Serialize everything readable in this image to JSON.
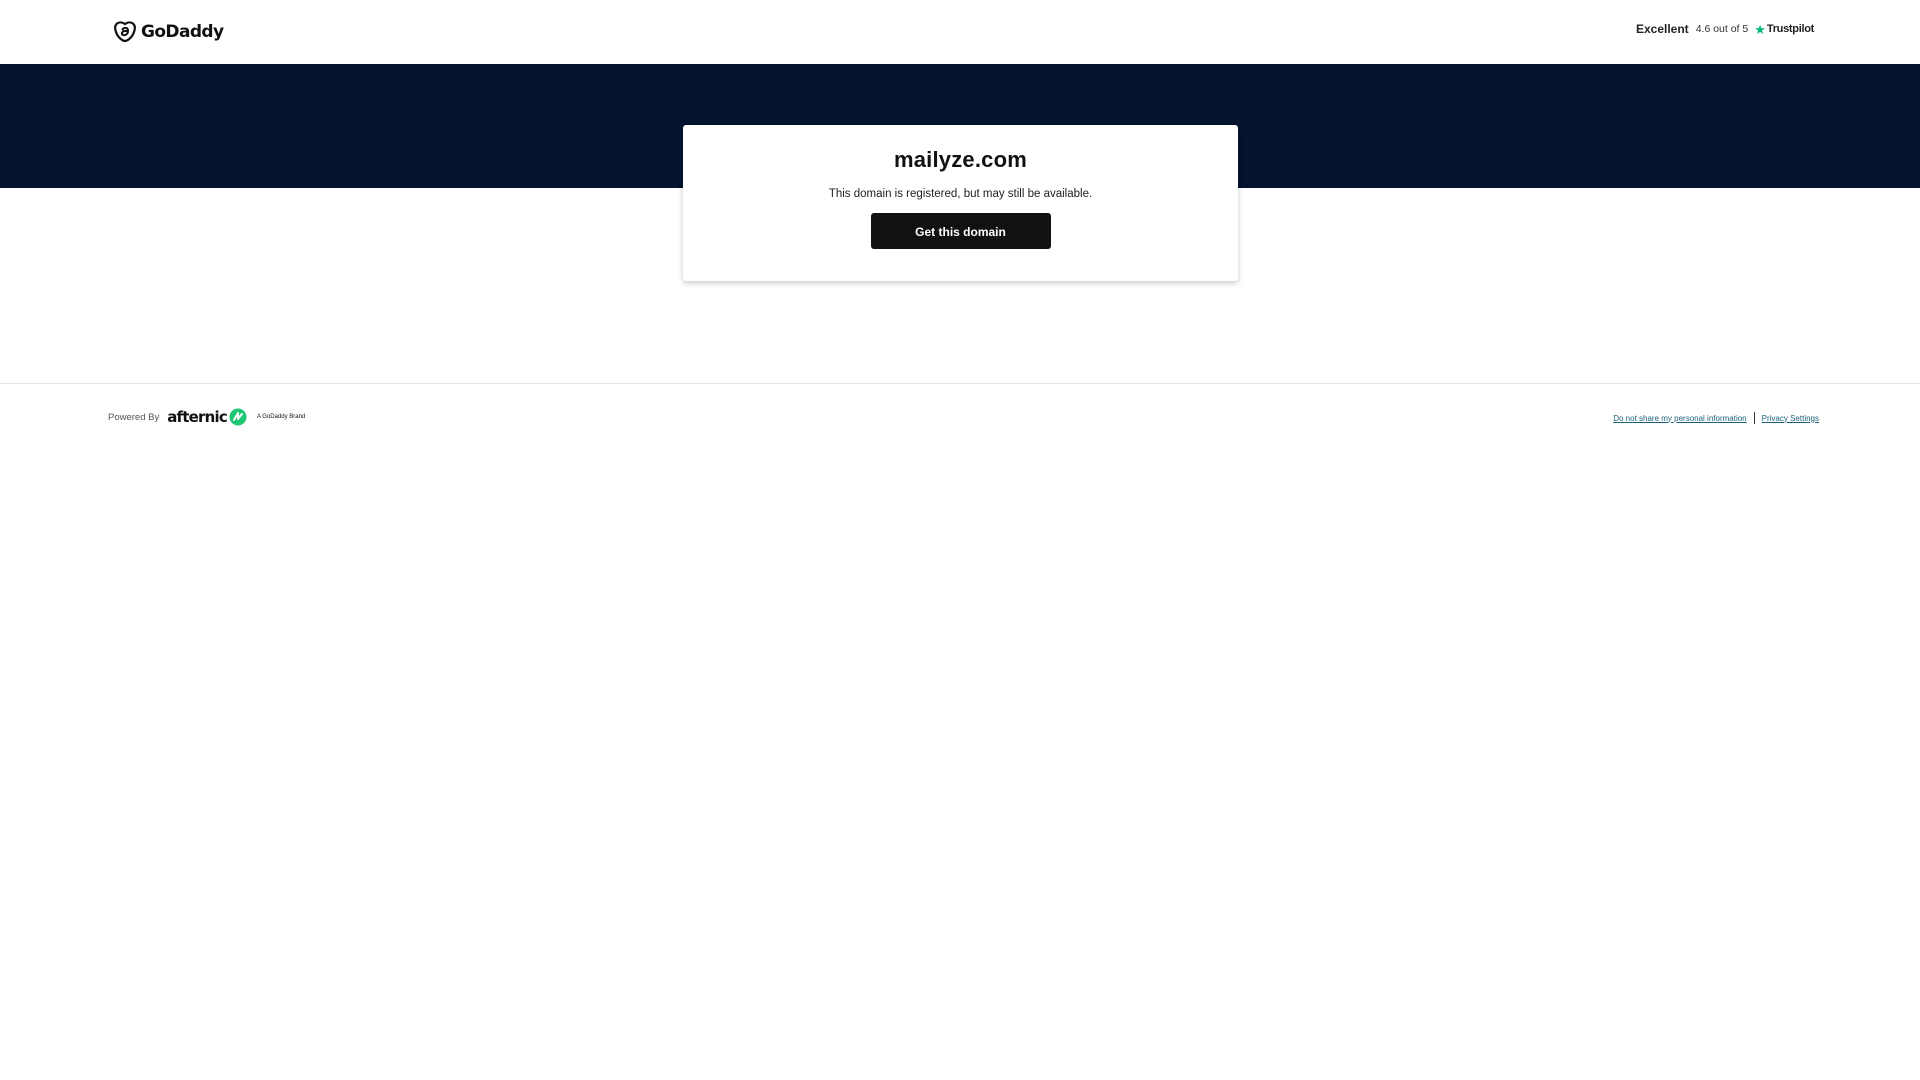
{
  "header": {
    "logo_text": "GoDaddy",
    "trustpilot": {
      "rating_word": "Excellent",
      "score_text": "4.6 out of 5",
      "brand": "Trustpilot",
      "star_color": "#00b67a"
    }
  },
  "banner": {
    "color": "#04132e"
  },
  "card": {
    "domain": "mailyze.com",
    "description": "This domain is registered, but may still be available.",
    "cta_label": "Get this domain"
  },
  "footer": {
    "powered_by": "Powered By",
    "afternic_logo_text": "afternic",
    "brand_tag": "A GoDaddy Brand",
    "links": {
      "do_not_share": "Do not share my personal information",
      "privacy_settings": "Privacy Settings"
    },
    "link_color": "#1a5f7a"
  },
  "icons": {
    "logo": "godaddy-logo-icon",
    "star": "trustpilot-star-icon",
    "afternic": "afternic-logo-icon"
  }
}
